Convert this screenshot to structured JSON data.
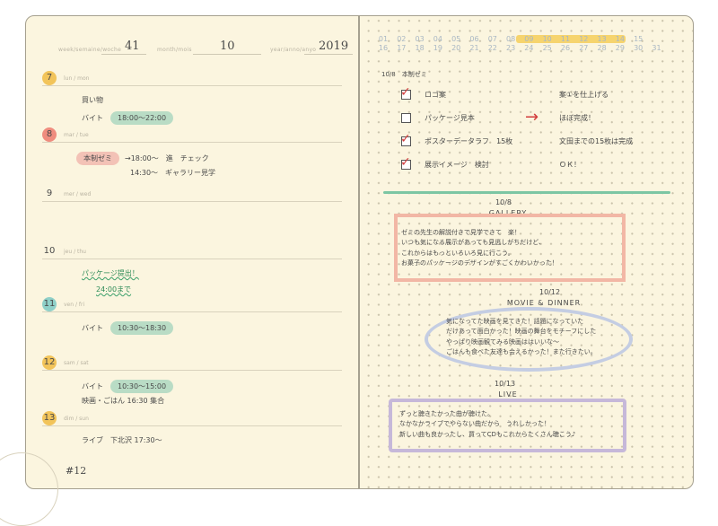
{
  "header": {
    "week_label": "week/semaine/woche",
    "week": "41",
    "month_label": "month/mois",
    "month": "10",
    "year_label": "year/anno/anyo",
    "year": "2019"
  },
  "days": [
    {
      "num": "7",
      "label": "lun / mon",
      "color": "#f2c45a",
      "entries": [
        {
          "text": "買い物",
          "pill": ""
        },
        {
          "text": "バイト",
          "pill": "18:00〜22:00",
          "pill_color": "green"
        }
      ]
    },
    {
      "num": "8",
      "label": "mar / tue",
      "color": "#ef8c7e",
      "entries": [
        {
          "text": "",
          "pill": "本制ゼミ",
          "pill_color": "pink",
          "after": "→18:00〜　進　チェック"
        },
        {
          "text": "14:30〜　ギャラリー見学",
          "pill": ""
        }
      ]
    },
    {
      "num": "9",
      "label": "mer / wed",
      "color": "",
      "entries": []
    },
    {
      "num": "10",
      "label": "jeu / thu",
      "color": "",
      "entries": [
        {
          "text": "パッケージ提出！",
          "pill": "",
          "wavy": true
        },
        {
          "text": "24:00まで",
          "pill": "",
          "wavy": true
        }
      ]
    },
    {
      "num": "11",
      "label": "ven / fri",
      "color": "#8fd0c8",
      "entries": [
        {
          "text": "バイト",
          "pill": "10:30〜18:30",
          "pill_color": "green"
        }
      ]
    },
    {
      "num": "12",
      "label": "sam / sat",
      "color": "#f2c45a",
      "entries": [
        {
          "text": "バイト",
          "pill": "10:30〜15:00",
          "pill_color": "green"
        },
        {
          "text": "映画・ごはん 16:30 集合",
          "pill": ""
        }
      ]
    },
    {
      "num": "13",
      "label": "dim / sun",
      "color": "#f2c45a",
      "entries": [
        {
          "text": "ライブ　下北沢 17:30〜",
          "pill": ""
        }
      ]
    }
  ],
  "page_number": "#12",
  "calendar_row1": [
    "01",
    "02",
    "03",
    "04",
    "05",
    "06",
    "07",
    "08",
    "09",
    "10",
    "11",
    "12",
    "13",
    "14",
    "15"
  ],
  "calendar_row2": [
    "16",
    "17",
    "18",
    "19",
    "20",
    "21",
    "22",
    "23",
    "24",
    "25",
    "26",
    "27",
    "28",
    "29",
    "30",
    "31"
  ],
  "todo_title": "10/8　本制ゼミ",
  "todos": [
    {
      "text": "ロゴ案",
      "status": "案①を仕上げる",
      "checked": true,
      "arrow": false
    },
    {
      "text": "パッケージ見本",
      "status": "ほぼ完成！",
      "checked": false,
      "arrow": true
    },
    {
      "text": "ポスターデータラフ　15枚",
      "status": "文田までの15枚は完成",
      "checked": true,
      "arrow": false
    },
    {
      "text": "展示イメージ　検討",
      "status": "ＯＫ！",
      "checked": true,
      "arrow": false
    }
  ],
  "sections": [
    {
      "date": "10/8",
      "title": "GALLERY",
      "frame_color": "#f2b7a5",
      "lines": [
        "ゼミの先生の解説付きで見学できて　楽！",
        "いつも気になる展示があっても見逃しがちだけど、",
        "これからはもっといろいろ見に行こう。",
        "お菓子のパッケージのデザインがすごくかわいかった！"
      ]
    },
    {
      "date": "10/12",
      "title": "MOVIE & DINNER",
      "frame_color": "#c4cde3",
      "lines": [
        "気になってた映画を見てきた！話題になっていた",
        "だけあって面白かった！映画の舞台をモチーフにした",
        "やっぱり映画観てみる映画ははいいな〜",
        "ごはんも食べた友達も会えるかった！また行きたい。"
      ]
    },
    {
      "date": "10/13",
      "title": "LIVE",
      "frame_color": "#c6b8d9",
      "lines": [
        "ずっと聴きたかった曲が聴けた。",
        "なかなかライブでやらない曲だから　うれしかった！",
        "新しい曲も良かったし、買ってCDもこれからたくさん聴こう♪"
      ]
    }
  ]
}
